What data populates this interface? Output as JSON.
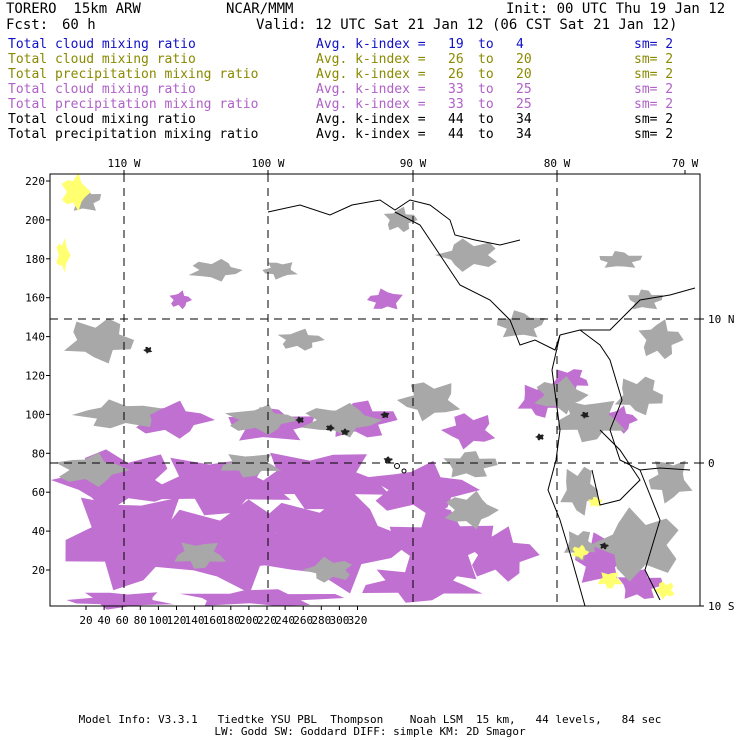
{
  "header": {
    "model": "TORERO  15km ARW",
    "org": "NCAR/MMM",
    "init": "Init: 00 UTC Thu 19 Jan 12",
    "fcst_label": "Fcst:",
    "fcst_value": "60 h",
    "valid": "Valid: 12 UTC Sat 21 Jan 12 (06 CST Sat 21 Jan 12)"
  },
  "legend": [
    {
      "field": "Total cloud mixing ratio",
      "avg": "Avg. k-index =",
      "k1": "19",
      "to": "to",
      "k2": "4",
      "sm": "sm= 2",
      "color": "#1010c8"
    },
    {
      "field": "Total cloud mixing ratio",
      "avg": "Avg. k-index =",
      "k1": "26",
      "to": "to",
      "k2": "20",
      "sm": "sm= 2",
      "color": "#8a8a00"
    },
    {
      "field": "Total precipitation mixing ratio",
      "avg": "Avg. k-index =",
      "k1": "26",
      "to": "to",
      "k2": "20",
      "sm": "sm= 2",
      "color": "#8a8a00"
    },
    {
      "field": "Total cloud mixing ratio",
      "avg": "Avg. k-index =",
      "k1": "33",
      "to": "to",
      "k2": "25",
      "sm": "sm= 2",
      "color": "#b060c8"
    },
    {
      "field": "Total precipitation mixing ratio",
      "avg": "Avg. k-index =",
      "k1": "33",
      "to": "to",
      "k2": "25",
      "sm": "sm= 2",
      "color": "#b060c8"
    },
    {
      "field": "Total cloud mixing ratio",
      "avg": "Avg. k-index =",
      "k1": "44",
      "to": "to",
      "k2": "34",
      "sm": "sm= 2",
      "color": "#000000"
    },
    {
      "field": "Total precipitation mixing ratio",
      "avg": "Avg. k-index =",
      "k1": "44",
      "to": "to",
      "k2": "34",
      "sm": "sm= 2",
      "color": "#000000"
    }
  ],
  "map": {
    "longitude_labels": [
      "110 W",
      "100 W",
      "90 W",
      "80 W",
      "70 W"
    ],
    "latitude_labels": [
      "10 N",
      "0",
      "10 S"
    ],
    "x_ticks": [
      "20",
      "40",
      "60",
      "80",
      "100",
      "120",
      "140",
      "160",
      "180",
      "200",
      "220",
      "240",
      "260",
      "280",
      "300",
      "320"
    ],
    "y_ticks": [
      "220",
      "200",
      "180",
      "160",
      "140",
      "120",
      "100",
      "80",
      "60",
      "40",
      "20"
    ],
    "colors": {
      "gray": "#a8a8a8",
      "magenta": "#c070d0",
      "yellow": "#ffff70",
      "dark": "#202020",
      "coast": "#000000"
    }
  },
  "footer": {
    "line1": "Model Info: V3.3.1   Tiedtke YSU PBL  Thompson    Noah LSM  15 km,   44 levels,   84 sec",
    "line2": "LW: Godd SW: Goddard DIFF: simple KM: 2D Smagor"
  }
}
